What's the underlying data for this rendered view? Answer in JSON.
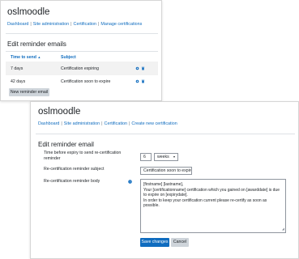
{
  "list_page": {
    "site_name": "oslmoodle",
    "breadcrumb": [
      "Dashboard",
      "Site administration",
      "Certification",
      "Manage certifications"
    ],
    "heading": "Edit reminder emails",
    "columns": {
      "time_to_send": "Time to send",
      "sort_indicator": "▲",
      "subject": "Subject"
    },
    "rows": [
      {
        "time": "7 days",
        "subject": "Certification expiring"
      },
      {
        "time": "42 days",
        "subject": "Certification soon to expire"
      }
    ],
    "new_button": "New reminder email",
    "icons": [
      "gear-icon",
      "trash-icon"
    ]
  },
  "edit_page": {
    "site_name": "oslmoodle",
    "breadcrumb": [
      "Dashboard",
      "Site administration",
      "Certification",
      "Create new certification"
    ],
    "heading": "Edit reminder email",
    "time_label": "Time before expiry to send re-certification reminder",
    "time_value": "6",
    "time_unit": "weeks",
    "subject_label": "Re-certification reminder subject",
    "subject_value": "Certification soon to expire",
    "body_label": "Re-certification reminder body",
    "body_lines": [
      "[firstname] [lastname],",
      "Your [certificationname] certification which you gained on [awarddate] is due to expire on [expirydate].",
      "In order to keep your certification current please re-certify as soon as possible."
    ],
    "save_button": "Save changes",
    "cancel_button": "Cancel"
  },
  "colors": {
    "link": "#0f6cbf",
    "primary_button": "#0f6cbf",
    "secondary_button": "#ced4da",
    "row_stripe": "#f2f2f2"
  }
}
